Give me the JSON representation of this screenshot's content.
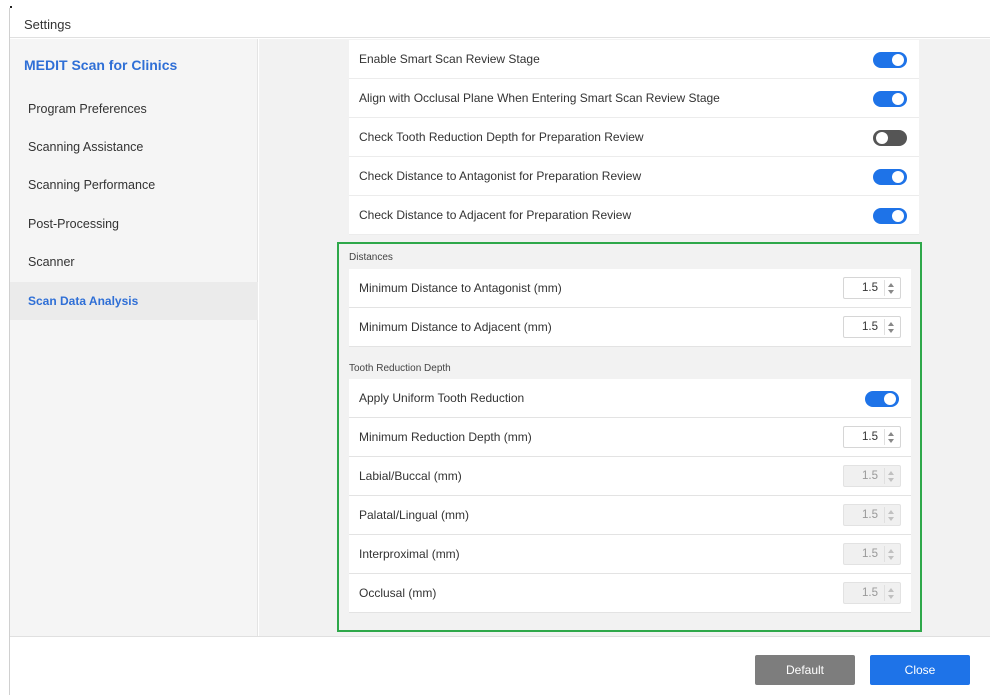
{
  "window": {
    "title": "Settings"
  },
  "sidebar": {
    "brand_bold": "MEDIT",
    "brand_rest": "Scan for Clinics",
    "items": [
      {
        "label": "Program Preferences"
      },
      {
        "label": "Scanning Assistance"
      },
      {
        "label": "Scanning Performance"
      },
      {
        "label": "Post-Processing"
      },
      {
        "label": "Scanner"
      },
      {
        "label": "Scan Data Analysis",
        "active": true
      }
    ]
  },
  "toggles": [
    {
      "label": "Enable Smart Scan Review Stage",
      "state": "on"
    },
    {
      "label": "Align with Occlusal Plane When Entering Smart Scan Review Stage",
      "state": "on"
    },
    {
      "label": "Check Tooth Reduction Depth for Preparation Review",
      "state": "off"
    },
    {
      "label": "Check Distance to Antagonist for Preparation Review",
      "state": "on"
    },
    {
      "label": "Check Distance to Adjacent for Preparation Review",
      "state": "on"
    }
  ],
  "distances": {
    "heading": "Distances",
    "rows": [
      {
        "label": "Minimum Distance to Antagonist (mm)",
        "value": "1.5"
      },
      {
        "label": "Minimum Distance to Adjacent (mm)",
        "value": "1.5"
      }
    ]
  },
  "reduction": {
    "heading": "Tooth Reduction Depth",
    "uniform": {
      "label": "Apply Uniform Tooth Reduction",
      "state": "on"
    },
    "rows": [
      {
        "label": "Minimum Reduction Depth (mm)",
        "value": "1.5",
        "disabled": false
      },
      {
        "label": "Labial/Buccal (mm)",
        "value": "1.5",
        "disabled": true
      },
      {
        "label": "Palatal/Lingual (mm)",
        "value": "1.5",
        "disabled": true
      },
      {
        "label": "Interproximal (mm)",
        "value": "1.5",
        "disabled": true
      },
      {
        "label": "Occlusal (mm)",
        "value": "1.5",
        "disabled": true
      }
    ]
  },
  "footer": {
    "default_label": "Default",
    "close_label": "Close"
  },
  "colors": {
    "accent": "#1e73e8",
    "highlight": "#2ea84a",
    "toggle_off": "#555555"
  }
}
